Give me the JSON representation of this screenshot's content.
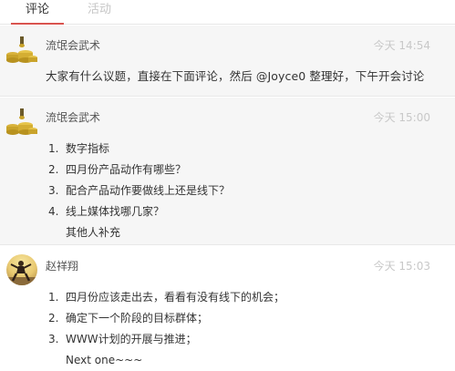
{
  "tabs": [
    {
      "label": "评论"
    },
    {
      "label": "活动"
    }
  ],
  "comments": [
    {
      "author": "流氓会武术",
      "time": "今天 14:54",
      "text": "大家有什么议题，直接在下面评论，然后 @Joyce0 整理好，下午开会讨论"
    },
    {
      "author": "流氓会武术",
      "time": "今天 15:00",
      "items": [
        {
          "num": "1.",
          "text": "数字指标"
        },
        {
          "num": "2.",
          "text": "四月份产品动作有哪些？"
        },
        {
          "num": "3.",
          "text": "配合产品动作要做线上还是线下？"
        },
        {
          "num": "4.",
          "text": "线上媒体找哪几家？"
        }
      ],
      "extra": "其他人补充"
    },
    {
      "author": "赵祥翔",
      "time": "今天 15:03",
      "items": [
        {
          "num": "1.",
          "text": "四月份应该走出去，看看有没有线下的机会；"
        },
        {
          "num": "2.",
          "text": "确定下一个阶段的目标群体；"
        },
        {
          "num": "3.",
          "text": "WWW计划的开展与推进；"
        }
      ],
      "extra": "Next one~~~"
    }
  ],
  "colors": {
    "accent": "#d9534f",
    "muted": "#c8c8c8",
    "row_bg": "#f6f6f6"
  }
}
